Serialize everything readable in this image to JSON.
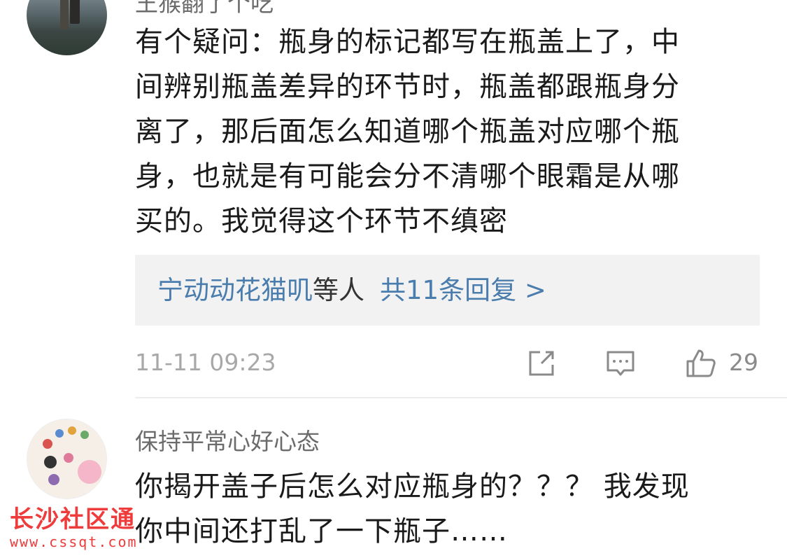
{
  "comment1": {
    "username": "王猴翻了个吃",
    "text_lines": [
      "有个疑问：瓶身的标记都写在瓶盖上了，中",
      "间辨别瓶盖差异的环节时，瓶盖都跟瓶身分",
      "离了，那后面怎么知道哪个瓶盖对应哪个瓶",
      "身，也就是有可能会分不清哪个眼霜是从哪",
      "买的。我觉得这个环节不缜密"
    ],
    "replies": {
      "who": "宁动动花猫叽",
      "etc": "等人",
      "count_label": "共11条回复 >"
    },
    "timestamp": "11-11 09:23",
    "like_count": "29"
  },
  "comment2": {
    "username": "保持平常心好心态",
    "text_lines": [
      "你揭开盖子后怎么对应瓶身的？？？ 我发现",
      "你中间还打乱了一下瓶子……"
    ]
  },
  "watermark": {
    "title": "长沙社区通",
    "url": "www.cssqt.com"
  },
  "icons": {
    "share": "share-icon",
    "reply": "reply-icon",
    "like": "thumbs-up-icon"
  },
  "colors": {
    "link": "#4a7dad",
    "meta": "#a8a8a8",
    "watermark": "#ee3b3b"
  }
}
